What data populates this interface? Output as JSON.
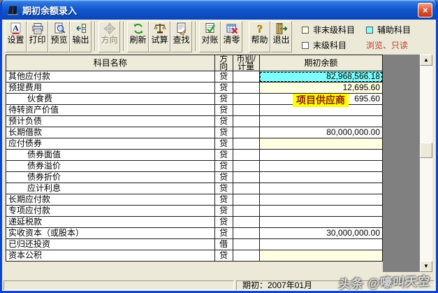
{
  "window": {
    "title": "期初余额录入"
  },
  "icons": {
    "close": "×",
    "up_arrow": "▲",
    "down_arrow": "▼"
  },
  "toolbar": {
    "buttons": [
      {
        "label": "设置",
        "icon": "settings-icon",
        "enabled": true
      },
      {
        "label": "打印",
        "icon": "print-icon",
        "enabled": true
      },
      {
        "label": "预览",
        "icon": "preview-icon",
        "enabled": true
      },
      {
        "label": "输出",
        "icon": "export-icon",
        "enabled": true,
        "sep_after": true
      },
      {
        "label": "方向",
        "icon": "direction-icon",
        "enabled": false,
        "sep_after": true
      },
      {
        "label": "刷新",
        "icon": "refresh-icon",
        "enabled": true
      },
      {
        "label": "试算",
        "icon": "trial-icon",
        "enabled": true
      },
      {
        "label": "查找",
        "icon": "find-icon",
        "enabled": true,
        "sep_after": true
      },
      {
        "label": "对账",
        "icon": "reconcile-icon",
        "enabled": true
      },
      {
        "label": "清零",
        "icon": "clear-icon",
        "enabled": true,
        "gap_after": true
      },
      {
        "label": "帮助",
        "icon": "help-icon",
        "enabled": true
      },
      {
        "label": "退出",
        "icon": "exit-icon",
        "enabled": true
      }
    ],
    "legend": {
      "non_leaf": "非末级科目",
      "leaf": "末级科目",
      "auxiliary": "辅助科目",
      "readonly_note": "浏览、只读"
    }
  },
  "table": {
    "columns": [
      "科目名称",
      "方向",
      "币别/计量",
      "期初余额"
    ],
    "tooltip": "项目供应商",
    "rows": [
      {
        "name": "其他应付款",
        "indent": false,
        "dir": "贷",
        "currency": "",
        "balance": "82,968,566.18",
        "highlight": "auxiliary"
      },
      {
        "name": "预提费用",
        "indent": false,
        "dir": "贷",
        "currency": "",
        "balance": "12,695.60",
        "highlight": "nonleaf"
      },
      {
        "name": "伙食费",
        "indent": true,
        "dir": "贷",
        "currency": "",
        "balance": "695.60",
        "highlight": ""
      },
      {
        "name": "待转资产价值",
        "indent": false,
        "dir": "贷",
        "currency": "",
        "balance": "",
        "highlight": ""
      },
      {
        "name": "预计负债",
        "indent": false,
        "dir": "贷",
        "currency": "",
        "balance": "",
        "highlight": ""
      },
      {
        "name": "长期借款",
        "indent": false,
        "dir": "贷",
        "currency": "",
        "balance": "80,000,000.00",
        "highlight": ""
      },
      {
        "name": "应付债券",
        "indent": false,
        "dir": "贷",
        "currency": "",
        "balance": "",
        "highlight": "nonleaf"
      },
      {
        "name": "债券面值",
        "indent": true,
        "dir": "贷",
        "currency": "",
        "balance": "",
        "highlight": ""
      },
      {
        "name": "债券溢价",
        "indent": true,
        "dir": "贷",
        "currency": "",
        "balance": "",
        "highlight": ""
      },
      {
        "name": "债券折价",
        "indent": true,
        "dir": "贷",
        "currency": "",
        "balance": "",
        "highlight": ""
      },
      {
        "name": "应计利息",
        "indent": true,
        "dir": "贷",
        "currency": "",
        "balance": "",
        "highlight": ""
      },
      {
        "name": "长期应付款",
        "indent": false,
        "dir": "贷",
        "currency": "",
        "balance": "",
        "highlight": ""
      },
      {
        "name": "专项应付款",
        "indent": false,
        "dir": "贷",
        "currency": "",
        "balance": "",
        "highlight": ""
      },
      {
        "name": "递延税款",
        "indent": false,
        "dir": "贷",
        "currency": "",
        "balance": "",
        "highlight": ""
      },
      {
        "name": "实收资本（或股本）",
        "indent": false,
        "dir": "贷",
        "currency": "",
        "balance": "30,000,000.00",
        "highlight": ""
      },
      {
        "name": "已归还投资",
        "indent": false,
        "dir": "借",
        "currency": "",
        "balance": "",
        "highlight": ""
      },
      {
        "name": "资本公积",
        "indent": false,
        "dir": "贷",
        "currency": "",
        "balance": "",
        "highlight": "nonleaf"
      }
    ]
  },
  "statusbar": {
    "period_label": "期初：2007年01月"
  },
  "watermark": "头条 @嚎叫天空",
  "colors": {
    "face": "#ECE9D8",
    "aux_cell": "#80FFFF",
    "nonleaf_cell": "#FFFFE1",
    "tooltip_bg": "#FFFF00",
    "tooltip_text": "#8B1A10",
    "readonly_text": "#C0392B",
    "grid_line": "#1A1A1A"
  }
}
